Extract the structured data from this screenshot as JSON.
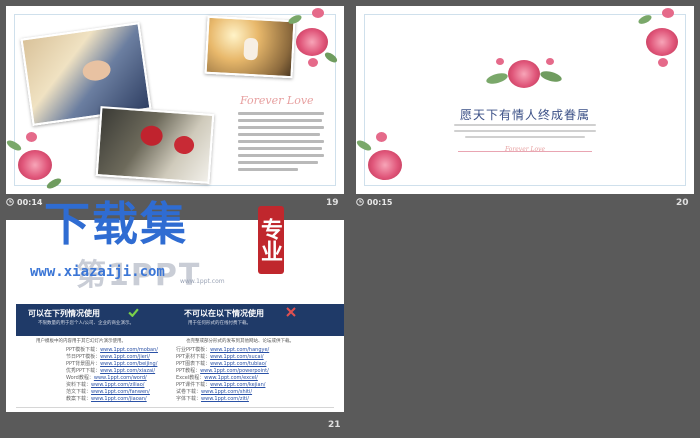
{
  "slides": [
    {
      "time": "00:14",
      "number": "19",
      "script_title": "Forever Love",
      "body_lines": 9
    },
    {
      "time": "00:15",
      "number": "20",
      "heading": "愿天下有情人终成眷属",
      "script_title": "Forever Love"
    },
    {
      "time": "",
      "number": "21",
      "left_banner": "可以在下列情况使用",
      "right_banner": "不可以在以下情况使用",
      "left_notes": [
        "不限数量的用于您个人/公司、企业的商业演示。",
        "用户模板中的内容用于其它幻灯片演示使用。"
      ],
      "right_notes": [
        "用于任何形式的在线付费下载。",
        "也完整或部分形式的发布到其他网站、论坛或供下载。"
      ],
      "links_left": [
        {
          "label": "PPT模板下载：",
          "url": "www.1ppt.com/moban/"
        },
        {
          "label": "节日PPT模板：",
          "url": "www.1ppt.com/jieri/"
        },
        {
          "label": "PPT背景图片：",
          "url": "www.1ppt.com/beijing/"
        },
        {
          "label": "优秀PPT下载：",
          "url": "www.1ppt.com/xiazai/"
        },
        {
          "label": "Word教程：",
          "url": "www.1ppt.com/word/"
        },
        {
          "label": "资料下载：",
          "url": "www.1ppt.com/ziliao/"
        },
        {
          "label": "范文下载：",
          "url": "www.1ppt.com/fanwen/"
        },
        {
          "label": "教案下载：",
          "url": "www.1ppt.com/jiaoan/"
        }
      ],
      "links_right": [
        {
          "label": "行业PPT模板：",
          "url": "www.1ppt.com/hangye/"
        },
        {
          "label": "PPT素材下载：",
          "url": "www.1ppt.com/sucai/"
        },
        {
          "label": "PPT图表下载：",
          "url": "www.1ppt.com/tubiao/"
        },
        {
          "label": "PPT教程：",
          "url": "www.1ppt.com/powerpoint/"
        },
        {
          "label": "Excel教程：",
          "url": "www.1ppt.com/excel/"
        },
        {
          "label": "PPT课件下载：",
          "url": "www.1ppt.com/kejian/"
        },
        {
          "label": "试卷下载：",
          "url": "www.1ppt.com/shiti/"
        },
        {
          "label": "字体下载：",
          "url": "www.1ppt.com/ziti/"
        }
      ]
    }
  ],
  "watermark": {
    "big_text": "下载集",
    "stamp_text": "专业",
    "url": "www.xiazaiji.com",
    "logo_text": "第1PPT",
    "logo_sub": "www.1ppt.com"
  },
  "colors": {
    "background": "#5a5a5a",
    "rose": "#e0567a",
    "banner": "#1f3a68",
    "watermark": "#2f6cd2"
  }
}
